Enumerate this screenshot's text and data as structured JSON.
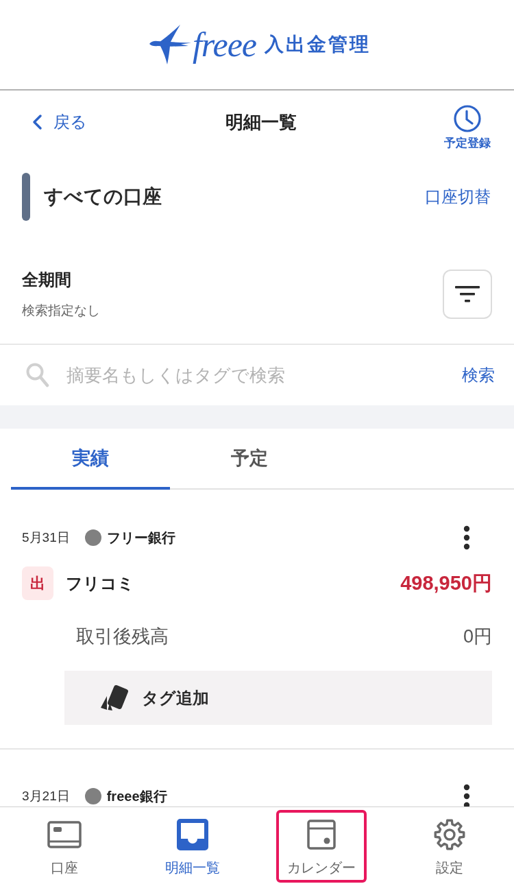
{
  "header": {
    "logo": {
      "brand": "freee",
      "product": "入出金管理"
    }
  },
  "nav_bar": {
    "back": "戻る",
    "title": "明細一覧",
    "action": "予定登録"
  },
  "account": {
    "name": "すべての口座",
    "switch": "口座切替"
  },
  "period": {
    "title": "全期間",
    "subtitle": "検索指定なし"
  },
  "search": {
    "placeholder": "摘要名もしくはタグで検索",
    "button": "検索"
  },
  "tabs": [
    {
      "label": "実績",
      "selected": true
    },
    {
      "label": "予定",
      "selected": false
    }
  ],
  "transactions": [
    {
      "date": "5月31日",
      "account": "フリー銀行",
      "color": "#808080",
      "outgoing": true,
      "badge": "出",
      "description": "フリコミ",
      "amount": "498,950円",
      "balance_label": "取引後残高",
      "balance": "0円",
      "tag_button": "タグ追加"
    },
    {
      "date": "3月21日",
      "account": "freee銀行",
      "color": "#808080"
    }
  ],
  "bottom_nav": [
    {
      "label": "口座",
      "selected": false,
      "highlighted": false
    },
    {
      "label": "明細一覧",
      "selected": true,
      "highlighted": false
    },
    {
      "label": "カレンダー",
      "selected": false,
      "highlighted": true
    },
    {
      "label": "設定",
      "selected": false,
      "highlighted": false
    }
  ]
}
